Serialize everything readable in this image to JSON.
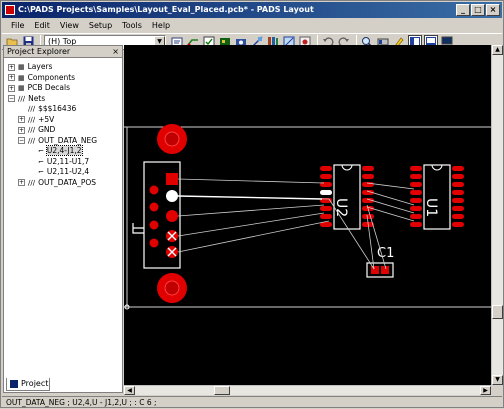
{
  "window": {
    "title": "C:\\PADS Projects\\Samples\\Layout_Eval_Placed.pcb* - PADS Layout",
    "controls": {
      "minimize": "_",
      "maximize": "□",
      "close": "×"
    }
  },
  "menu": [
    "File",
    "Edit",
    "View",
    "Setup",
    "Tools",
    "Help"
  ],
  "toolbar": {
    "layer_select": "(H) Top",
    "buttons_a": [
      "open-icon",
      "save-icon"
    ],
    "buttons_b": [
      "properties-icon",
      "route-icon",
      "verify-icon",
      "board-icon",
      "cam-icon",
      "design-icon",
      "library-icon",
      "plane-icon",
      "drc-icon"
    ],
    "buttons_c": [
      "undo-icon",
      "redo-icon",
      "zoom-icon",
      "toolbar-icon",
      "highlight-icon",
      "explorer-toggle-icon",
      "output-icon",
      "display-icon"
    ]
  },
  "explorer": {
    "title": "Project Explorer",
    "close": "×",
    "tab": "Project",
    "tree": [
      {
        "label": "Layers",
        "depth": 1,
        "expander": "+",
        "icon": "layers-icon"
      },
      {
        "label": "Components",
        "depth": 1,
        "expander": "+",
        "icon": "components-icon"
      },
      {
        "label": "PCB Decals",
        "depth": 1,
        "expander": "+",
        "icon": "decals-icon"
      },
      {
        "label": "Nets",
        "depth": 1,
        "expander": "−",
        "icon": "nets-icon"
      },
      {
        "label": "$$$16436",
        "depth": 2,
        "expander": "",
        "icon": "net-icon"
      },
      {
        "label": "+5V",
        "depth": 2,
        "expander": "+",
        "icon": "net-icon"
      },
      {
        "label": "GND",
        "depth": 2,
        "expander": "+",
        "icon": "net-icon"
      },
      {
        "label": "OUT_DATA_NEG",
        "depth": 2,
        "expander": "−",
        "icon": "net-icon"
      },
      {
        "label": "U2,4-J1,2",
        "depth": 3,
        "expander": "",
        "icon": "connection-icon",
        "selected": true
      },
      {
        "label": "U2,11-U1,7",
        "depth": 3,
        "expander": "",
        "icon": "connection-icon"
      },
      {
        "label": "U2,11-U2,4",
        "depth": 3,
        "expander": "",
        "icon": "connection-icon"
      },
      {
        "label": "OUT_DATA_POS",
        "depth": 2,
        "expander": "+",
        "icon": "net-icon"
      }
    ]
  },
  "canvas": {
    "ref_designators": [
      "U2",
      "U1",
      "C1"
    ],
    "colors": {
      "background": "#000000",
      "pad": "#e00000",
      "silkscreen": "#ffffff",
      "ratsnest": "#cfcfcf"
    }
  },
  "status": "OUT_DATA_NEG ; U2,4,U - J1,2,U ; : C 6 ;"
}
